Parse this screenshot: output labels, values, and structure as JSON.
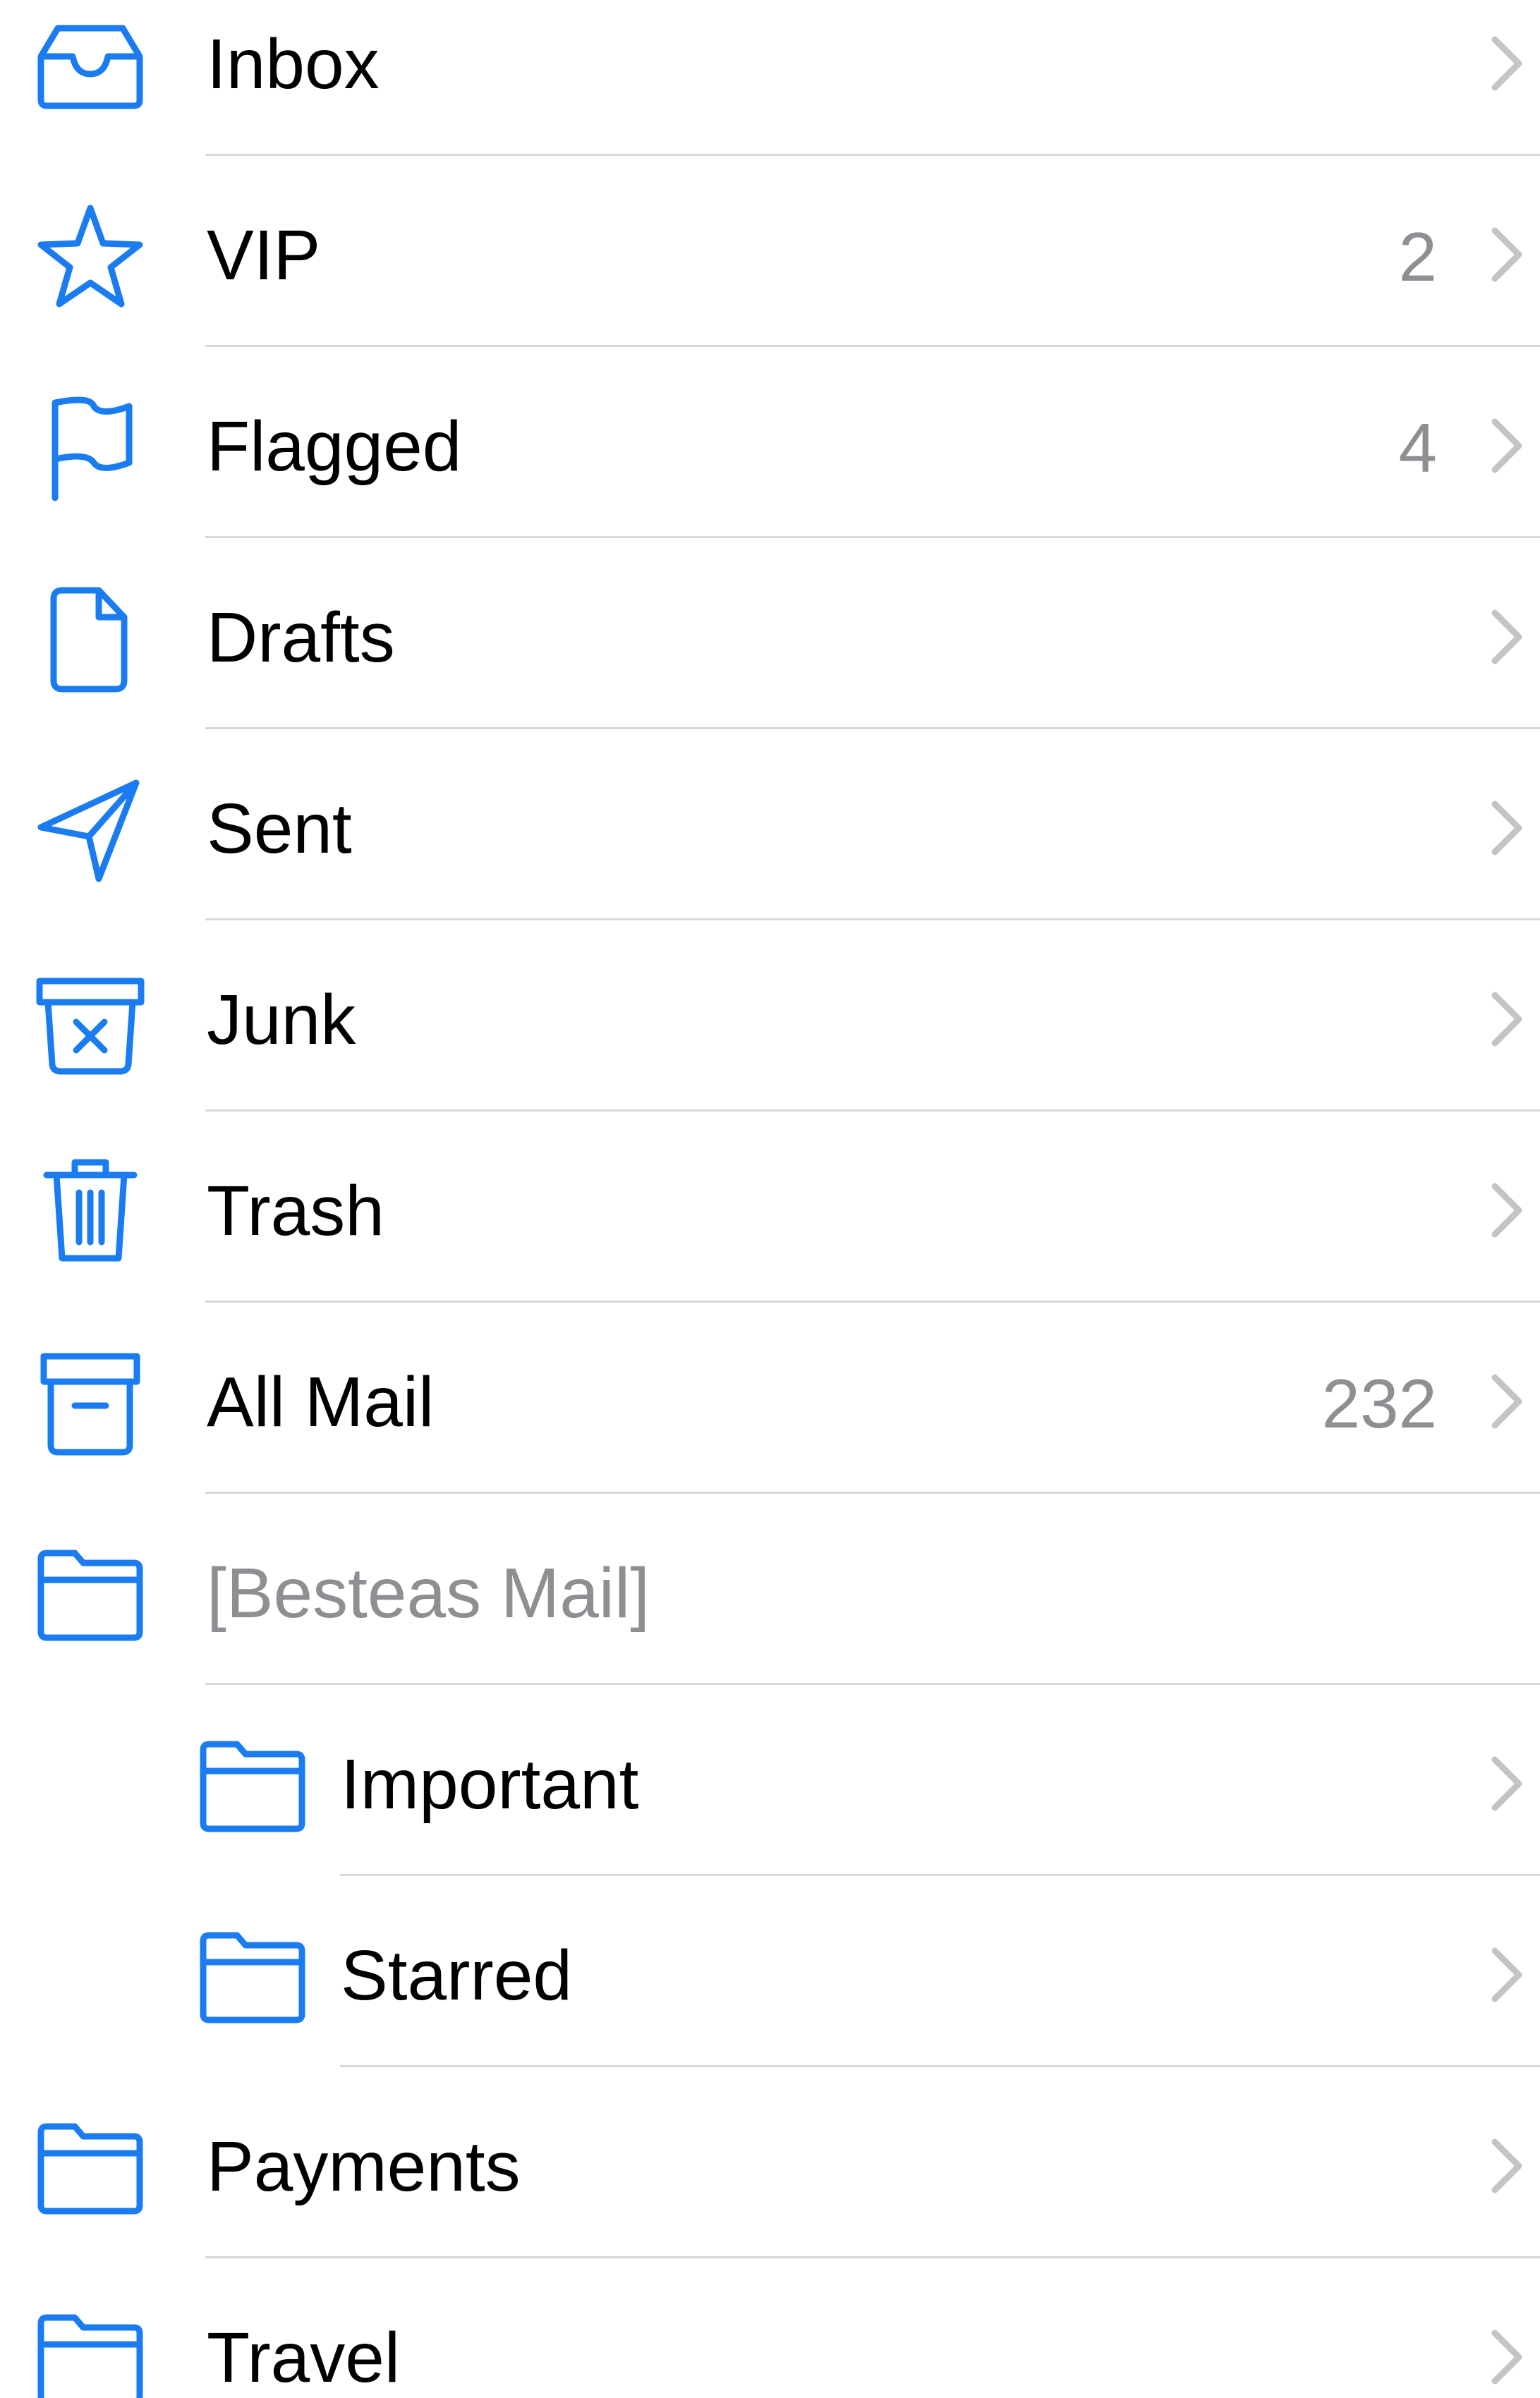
{
  "colors": {
    "accent": "#1a7cf0",
    "text": "#000000",
    "secondary": "#8e8e93",
    "separator": "#d9d9dc"
  },
  "mailboxes": [
    {
      "label": "Inbox",
      "count": "",
      "icon": "inbox-tray-icon"
    },
    {
      "label": "VIP",
      "count": "2",
      "icon": "star-icon"
    },
    {
      "label": "Flagged",
      "count": "4",
      "icon": "flag-icon"
    },
    {
      "label": "Drafts",
      "count": "",
      "icon": "document-icon"
    },
    {
      "label": "Sent",
      "count": "",
      "icon": "paper-plane-icon"
    },
    {
      "label": "Junk",
      "count": "",
      "icon": "junk-bin-icon"
    },
    {
      "label": "Trash",
      "count": "",
      "icon": "trash-icon"
    },
    {
      "label": "All Mail",
      "count": "232",
      "icon": "archive-box-icon"
    },
    {
      "label": "[Besteas Mail]",
      "count": "",
      "icon": "folder-icon"
    },
    {
      "label": "Important",
      "count": "",
      "icon": "folder-icon"
    },
    {
      "label": "Starred",
      "count": "",
      "icon": "folder-icon"
    },
    {
      "label": "Payments",
      "count": "",
      "icon": "folder-icon"
    },
    {
      "label": "Travel",
      "count": "",
      "icon": "folder-icon"
    }
  ]
}
